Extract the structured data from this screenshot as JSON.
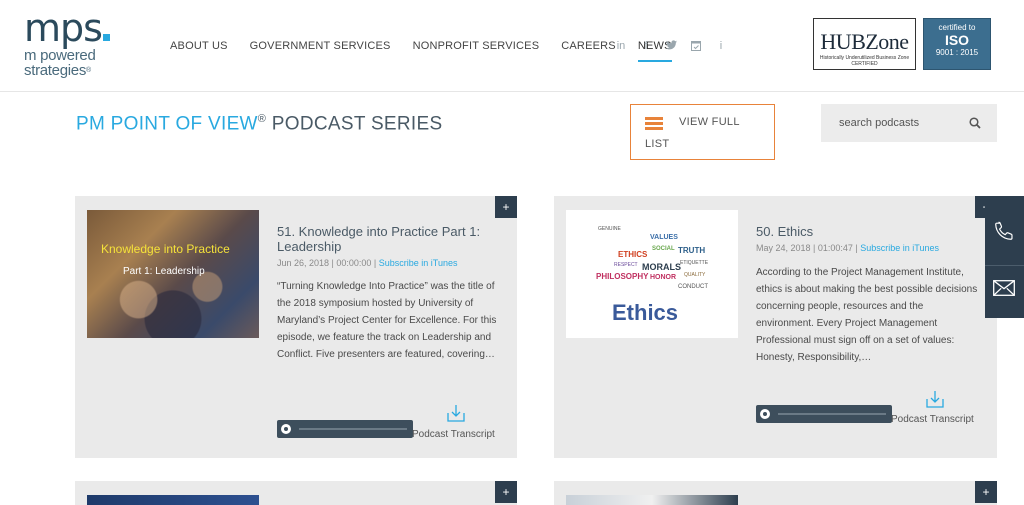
{
  "brand": {
    "logo_main": "mps",
    "logo_line1": "m powered",
    "logo_line2": "strategies",
    "logo_trademark": "®",
    "accent_color": "#29a9e0",
    "dark_color": "#2d3e4e",
    "orange_color": "#e8833a"
  },
  "nav": {
    "items": [
      {
        "label": "ABOUT US",
        "active": false
      },
      {
        "label": "GOVERNMENT SERVICES",
        "active": false
      },
      {
        "label": "NONPROFIT SERVICES",
        "active": false
      },
      {
        "label": "CAREERS",
        "active": false
      },
      {
        "label": "NEWS",
        "active": true
      }
    ],
    "socials": [
      {
        "icon": "linkedin-icon",
        "glyph": "in"
      },
      {
        "icon": "facebook-icon",
        "glyph": "f"
      },
      {
        "icon": "twitter-icon",
        "glyph": "🐦"
      },
      {
        "icon": "calendar-icon",
        "glyph": "▣"
      },
      {
        "icon": "info-icon",
        "glyph": "i"
      }
    ]
  },
  "certs": {
    "hubzone_title": "HUBZone",
    "hubzone_sub1": "Historically Underutilized Business Zone",
    "hubzone_sub2": "CERTIFIED",
    "iso_line1": "certified to",
    "iso_line2": "ISO",
    "iso_line3": "9001 : 2015"
  },
  "page": {
    "title_blue": "PM POINT OF VIEW",
    "title_reg": "®",
    "title_dark": " PODCAST SERIES",
    "view_full_line1": "VIEW FULL",
    "view_full_line2": "LIST",
    "search_placeholder": "search podcasts"
  },
  "episodes": [
    {
      "title": "51. Knowledge into Practice Part 1: Leadership",
      "date": "Jun 26, 2018 | 00:00:00 | ",
      "subscribe": "Subscribe in iTunes",
      "description": "“Turning Knowledge Into Practice” was the title of the 2018 symposium hosted by University of Maryland’s Project Center for Excellence. For this episode, we feature the track on Leadership and Conflict. Five presenters are featured, covering…",
      "thumb_line1": "Knowledge into Practice",
      "thumb_line2": "Part 1:  Leadership",
      "transcript": "Podcast Transcript",
      "progress": 0
    },
    {
      "title": "50. Ethics",
      "date": "May 24, 2018 | 01:00:47 | ",
      "subscribe": "Subscribe in iTunes",
      "description": "According to the Project Management Institute, ethics is about making the best possible decisions concerning people, resources and the environment. Every Project Management Professional must sign off on a set of values: Honesty, Responsibility,…",
      "thumb_word": "Ethics",
      "thumb_cloud": [
        "VALUES",
        "TRUTH",
        "ETHICS",
        "MORALS",
        "HONOR",
        "PHILOSOPHY",
        "SOCIAL",
        "CONDUCT",
        "ETIQUETTE",
        "QUALITY",
        "RESPECT",
        "GENUINE"
      ],
      "transcript": "Podcast Transcript",
      "progress": 0
    }
  ],
  "plus_label": "+",
  "side": {
    "phone_icon": "phone-icon",
    "mail_icon": "mail-icon"
  }
}
